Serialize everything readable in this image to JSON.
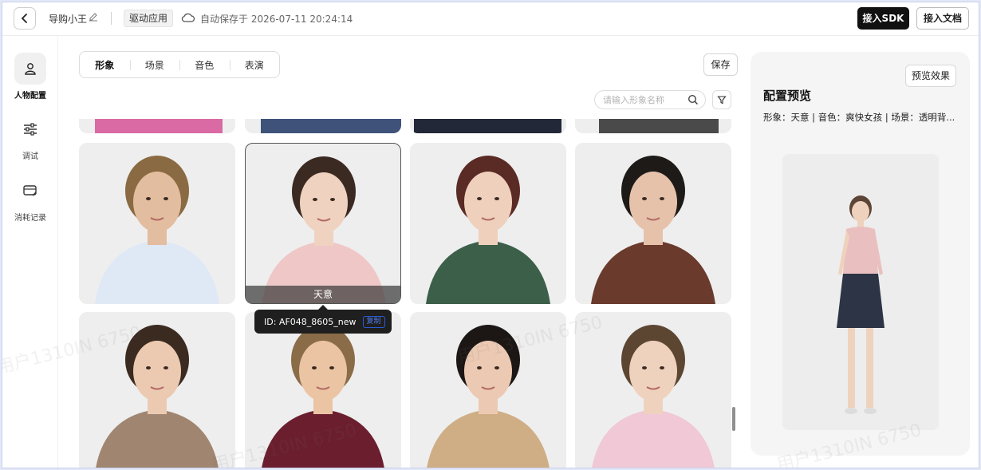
{
  "header": {
    "app_name": "导购小王",
    "drive_tag": "驱动应用",
    "autosave": "自动保存于 2026-07-11 20:24:14",
    "sdk_button": "接入SDK",
    "doc_button": "接入文档"
  },
  "sidebar": {
    "items": [
      {
        "label": "人物配置",
        "icon": "person-icon",
        "active": true
      },
      {
        "label": "调试",
        "icon": "sliders-icon",
        "active": false
      },
      {
        "label": "消耗记录",
        "icon": "card-icon",
        "active": false
      }
    ]
  },
  "tabs": [
    "形象",
    "场景",
    "音色",
    "表演"
  ],
  "toolbar": {
    "save_label": "保存",
    "search_placeholder": "请输入形象名称"
  },
  "avatars": [
    {
      "name": "",
      "skin": "#e3bd9f",
      "hair": "#8a6a42",
      "cloth": "#dfe9f5",
      "bg": "#eeeeee"
    },
    {
      "name": "天意",
      "skin": "#efd2bf",
      "hair": "#3b2a22",
      "cloth": "#efc7c7",
      "bg": "#eeeeee"
    },
    {
      "name": "",
      "skin": "#efd0bd",
      "hair": "#5a2a24",
      "cloth": "#3c5f4a",
      "bg": "#eeeeee"
    },
    {
      "name": "",
      "skin": "#e6c2aa",
      "hair": "#1e1a18",
      "cloth": "#6a3a2c",
      "bg": "#eeeeee"
    },
    {
      "name": "",
      "skin": "#eccab2",
      "hair": "#3a2a20",
      "cloth": "#a08570",
      "bg": "#eeeeee"
    },
    {
      "name": "",
      "skin": "#ebc4a4",
      "hair": "#8a6c48",
      "cloth": "#6b1e2e",
      "bg": "#eeeeee"
    },
    {
      "name": "",
      "skin": "#ecc9b2",
      "hair": "#1c1714",
      "cloth": "#cfae86",
      "bg": "#eeeeee"
    },
    {
      "name": "",
      "skin": "#efd2be",
      "hair": "#5c4632",
      "cloth": "#f0c8d6",
      "bg": "#eeeeee"
    }
  ],
  "tooltip": {
    "id_text": "ID: AF048_8605_new",
    "copy_label": "复制"
  },
  "preview": {
    "button": "预览效果",
    "title": "配置预览",
    "summary": "形象：天意 | 音色：爽快女孩 | 场景：透明背..."
  },
  "watermarks": [
    "用户1310IN 6750",
    "用户1310IN 6750",
    "用户1310IN 6750",
    "用户1310IN 6750"
  ],
  "colors": {
    "accent": "#111111",
    "copy_tag": "#4e7cf0"
  }
}
